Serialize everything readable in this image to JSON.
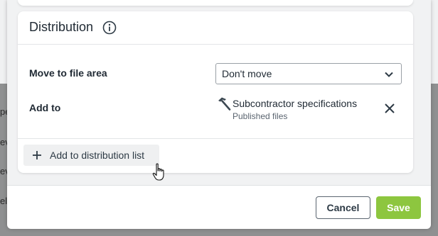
{
  "background": {
    "fragments": [
      "pe",
      "ev",
      "ev",
      "ele"
    ]
  },
  "distribution": {
    "title": "Distribution",
    "info_icon": "info-circle-icon",
    "move_label": "Move to file area",
    "move_value": "Don't move",
    "add_to_label": "Add to",
    "destination": {
      "name": "Subcontractor specifications",
      "sub": "Published files",
      "icon": "hammer-icon"
    },
    "add_dist_label": "Add to distribution list"
  },
  "footer": {
    "cancel_label": "Cancel",
    "save_label": "Save"
  },
  "colors": {
    "save": "#8dc63f",
    "text": "#1f2933",
    "muted": "#5b6570"
  }
}
